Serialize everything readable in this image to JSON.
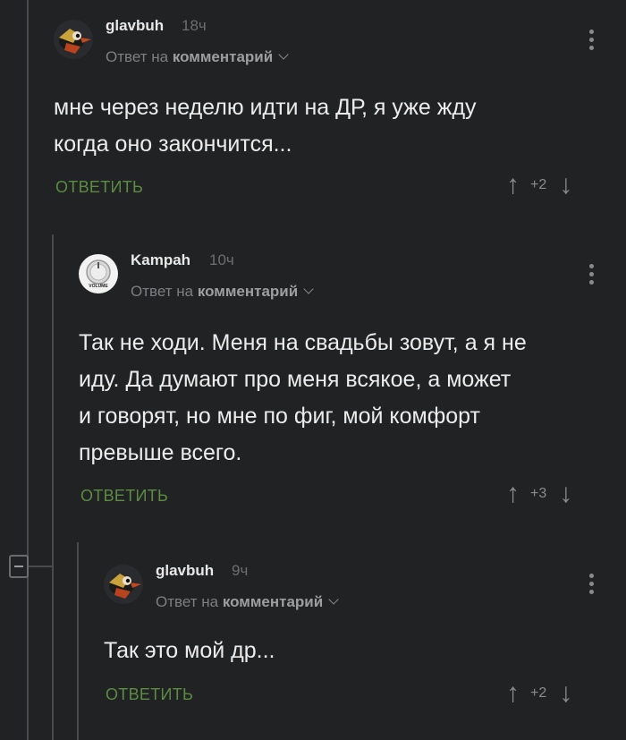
{
  "colors": {
    "background": "#212224",
    "reply_green": "#5b8c41",
    "thread_line": "#4a4b4e"
  },
  "comments": [
    {
      "author": "glavbuh",
      "time": "18ч",
      "reply_prefix": "Ответ на",
      "reply_target": "комментарий",
      "text_lines": [
        "мне через неделю идти на ДР, я уже жду",
        "когда оно закончится..."
      ],
      "reply_label": "ОТВЕТИТЬ",
      "score": "+2",
      "avatar": "duck-avatar"
    },
    {
      "author": "Kampah",
      "time": "10ч",
      "reply_prefix": "Ответ на",
      "reply_target": "комментарий",
      "text_lines": [
        "Так не ходи. Меня на свадьбы зовут, а я не",
        "иду. Да думают про меня всякое, а может",
        "и говорят, но мне по фиг, мой комфорт",
        "превыше всего."
      ],
      "reply_label": "ОТВЕТИТЬ",
      "score": "+3",
      "avatar": "volume-knob-avatar",
      "avatar_text": "VOLUME"
    },
    {
      "author": "glavbuh",
      "time": "9ч",
      "reply_prefix": "Ответ на",
      "reply_target": "комментарий",
      "text_lines": [
        "Так это мой др..."
      ],
      "reply_label": "ОТВЕТИТЬ",
      "score": "+2",
      "avatar": "duck-avatar"
    }
  ],
  "icons": {
    "upvote": "↑",
    "downvote": "↓"
  }
}
